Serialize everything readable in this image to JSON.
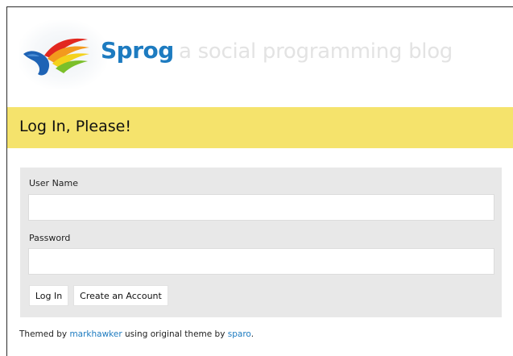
{
  "header": {
    "brand": "Sprog",
    "tagline": "a social programming blog"
  },
  "page": {
    "title": "Log In, Please!"
  },
  "form": {
    "username_label": "User Name",
    "username_value": "",
    "password_label": "Password",
    "password_value": "",
    "login_button": "Log In",
    "create_account_button": "Create an Account"
  },
  "footer": {
    "prefix": "Themed by ",
    "theme_author": "markhawker",
    "middle": " using original theme by ",
    "original_author": "sparo",
    "suffix": "."
  },
  "colors": {
    "brand": "#1d7bc0",
    "title_bar": "#f5e36c",
    "form_bg": "#e8e8e8",
    "link": "#1d7bc0"
  },
  "icons": {
    "logo": "sprog-bird-logo"
  }
}
